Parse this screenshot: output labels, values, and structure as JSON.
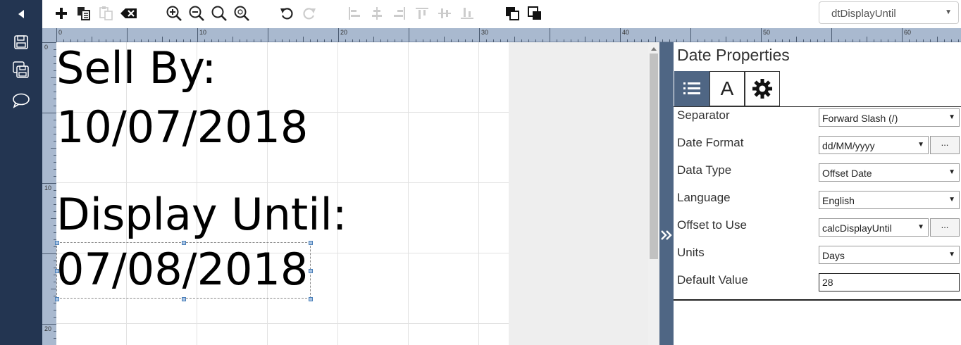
{
  "object_selector": {
    "value": "dtDisplayUntil"
  },
  "ruler": {
    "h_labels": [
      "0",
      "10",
      "20",
      "30",
      "40",
      "50",
      "60"
    ],
    "v_labels": [
      "0",
      "10",
      "20"
    ]
  },
  "label_texts": {
    "sell_by": "Sell By:",
    "sell_by_date": "10/07/2018",
    "display_until": "Display Until:",
    "display_until_date": "07/08/2018"
  },
  "properties": {
    "title": "Date Properties",
    "tabs": [
      {
        "icon": "list-icon",
        "label": ""
      },
      {
        "icon": "font-icon",
        "label": "A"
      },
      {
        "icon": "gear-icon",
        "label": ""
      }
    ],
    "separator": {
      "label": "Separator",
      "value": "Forward Slash (/)"
    },
    "date_format": {
      "label": "Date Format",
      "value": "dd/MM/yyyy",
      "button": "..."
    },
    "data_type": {
      "label": "Data Type",
      "value": "Offset Date"
    },
    "language": {
      "label": "Language",
      "value": "English"
    },
    "offset_to_use": {
      "label": "Offset to Use",
      "value": "calcDisplayUntil",
      "button": "..."
    },
    "units": {
      "label": "Units",
      "value": "Days"
    },
    "default_value": {
      "label": "Default Value",
      "value": "28"
    }
  }
}
